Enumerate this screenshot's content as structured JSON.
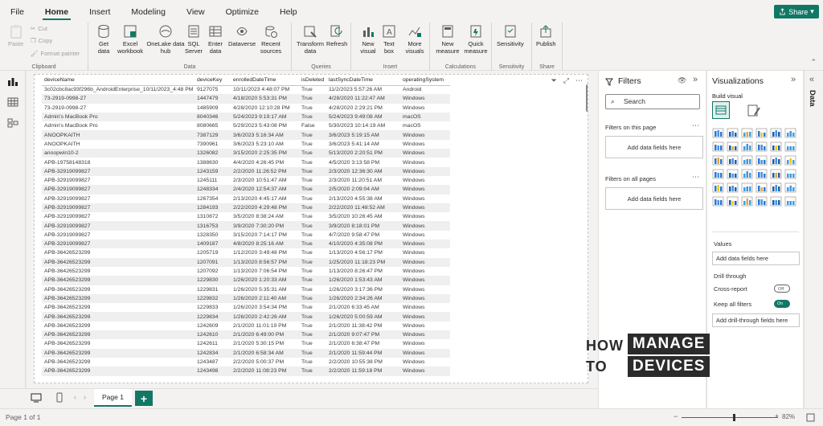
{
  "menu": {
    "items": [
      "File",
      "Home",
      "Insert",
      "Modeling",
      "View",
      "Optimize",
      "Help"
    ],
    "active": "Home",
    "share_label": "Share"
  },
  "ribbon": {
    "clipboard": {
      "paste": "Paste",
      "cut": "Cut",
      "copy": "Copy",
      "format_painter": "Format painter",
      "label": "Clipboard"
    },
    "data": {
      "get_data": "Get data",
      "excel": "Excel workbook",
      "onelake": "OneLake data hub",
      "sql": "SQL Server",
      "enter": "Enter data",
      "dataverse": "Dataverse",
      "recent": "Recent sources",
      "label": "Data"
    },
    "queries": {
      "transform": "Transform data",
      "refresh": "Refresh",
      "label": "Queries"
    },
    "insert": {
      "new_visual": "New visual",
      "text_box": "Text box",
      "more_visuals": "More visuals",
      "label": "Insert"
    },
    "calculations": {
      "new_measure": "New measure",
      "quick_measure": "Quick measure",
      "label": "Calculations"
    },
    "sensitivity": {
      "sensitivity": "Sensitivity",
      "label": "Sensitivity"
    },
    "share": {
      "publish": "Publish",
      "label": "Share"
    }
  },
  "table": {
    "columns": [
      "deviceName",
      "deviceKey",
      "enrolledDateTime",
      "isDeleted",
      "lastSyncDateTime",
      "operatingSystem"
    ],
    "rows": [
      [
        "3c02cbc8ac93f296b_AndroidEnterprise_10/11/2023_4:48 PM",
        "9127075",
        "10/11/2023 4:48:07 PM",
        "True",
        "11/2/2023 5:57:26 AM",
        "Android"
      ],
      [
        "73-2919-0998-27",
        "1447479",
        "4/18/2020 5:53:31 PM",
        "True",
        "4/28/2020 11:22:47 AM",
        "Windows"
      ],
      [
        "73-2919-0998-27",
        "1485909",
        "4/28/2020 12:10:28 PM",
        "True",
        "4/28/2020 2:29:21 PM",
        "Windows"
      ],
      [
        "Admin's MacBook Pro",
        "8040346",
        "5/24/2023 9:19:17 AM",
        "True",
        "5/24/2023 9:49:08 AM",
        "macOS"
      ],
      [
        "Admin's MacBook Pro",
        "8080665",
        "5/29/2023 5:43:08 PM",
        "False",
        "5/30/2023 10:14:19 AM",
        "macOS"
      ],
      [
        "ANOOPKAITH",
        "7387129",
        "3/6/2023 5:16:34 AM",
        "True",
        "3/6/2023 5:19:15 AM",
        "Windows"
      ],
      [
        "ANOOPKAITH",
        "7390961",
        "3/6/2023 5:23:10 AM",
        "True",
        "3/6/2023 5:41:14 AM",
        "Windows"
      ],
      [
        "anoopwin10-2",
        "1326082",
        "3/15/2020 2:25:35 PM",
        "True",
        "5/13/2020 2:20:51 PM",
        "Windows"
      ],
      [
        "APB-19758148318",
        "1388630",
        "4/4/2020 4:26:45 PM",
        "True",
        "4/5/2020 3:13:58 PM",
        "Windows"
      ],
      [
        "APB-32919099827",
        "1243159",
        "2/2/2020 11:26:52 PM",
        "True",
        "2/3/2020 12:36:30 AM",
        "Windows"
      ],
      [
        "APB-32919099827",
        "1245111",
        "2/3/2020 10:51:47 AM",
        "True",
        "2/3/2020 11:20:51 AM",
        "Windows"
      ],
      [
        "APB-32919099827",
        "1248334",
        "2/4/2020 12:54:37 AM",
        "True",
        "2/5/2020 2:09:04 AM",
        "Windows"
      ],
      [
        "APB-32919099827",
        "1267354",
        "2/13/2020 4:45:17 AM",
        "True",
        "2/13/2020 4:55:38 AM",
        "Windows"
      ],
      [
        "APB-32919099827",
        "1284193",
        "2/22/2020 4:29:48 PM",
        "True",
        "2/22/2020 11:48:52 AM",
        "Windows"
      ],
      [
        "APB-32919099827",
        "1310872",
        "3/5/2020 8:38:24 AM",
        "True",
        "3/5/2020 10:26:45 AM",
        "Windows"
      ],
      [
        "APB-32919099827",
        "1316753",
        "3/9/2020 7:30:20 PM",
        "True",
        "3/9/2020 8:18:01 PM",
        "Windows"
      ],
      [
        "APB-32919099827",
        "1328350",
        "3/15/2020 7:14:17 PM",
        "True",
        "4/7/2020 9:58:47 PM",
        "Windows"
      ],
      [
        "APB-32919099827",
        "1409187",
        "4/8/2020 8:25:16 AM",
        "True",
        "4/10/2020 4:35:08 PM",
        "Windows"
      ],
      [
        "APB-36426523299",
        "1205719",
        "1/12/2020 3:49:48 PM",
        "True",
        "1/13/2020 4:56:17 PM",
        "Windows"
      ],
      [
        "APB-36426523299",
        "1207091",
        "1/13/2020 8:56:57 PM",
        "True",
        "1/25/2020 11:18:23 PM",
        "Windows"
      ],
      [
        "APB-36426523299",
        "1207092",
        "1/13/2020 7:06:54 PM",
        "True",
        "1/13/2020 8:26:47 PM",
        "Windows"
      ],
      [
        "APB-36426523299",
        "1229830",
        "1/26/2020 1:20:33 AM",
        "True",
        "1/26/2020 1:53:43 AM",
        "Windows"
      ],
      [
        "APB-36426523299",
        "1229831",
        "1/26/2020 5:35:31 AM",
        "True",
        "1/26/2020 3:17:36 PM",
        "Windows"
      ],
      [
        "APB-36426523299",
        "1229832",
        "1/26/2020 2:11:40 AM",
        "True",
        "1/26/2020 2:34:26 AM",
        "Windows"
      ],
      [
        "APB-36426523299",
        "1229833",
        "1/26/2020 3:54:34 PM",
        "True",
        "2/1/2020 6:33:45 AM",
        "Windows"
      ],
      [
        "APB-36426523299",
        "1229834",
        "1/26/2020 2:42:26 AM",
        "True",
        "1/26/2020 5:00:59 AM",
        "Windows"
      ],
      [
        "APB-36426523299",
        "1242609",
        "2/1/2020 11:01:19 PM",
        "True",
        "2/1/2020 11:38:42 PM",
        "Windows"
      ],
      [
        "APB-36426523299",
        "1242610",
        "2/1/2020 6:49:00 PM",
        "True",
        "2/1/2020 9:07:47 PM",
        "Windows"
      ],
      [
        "APB-36426523299",
        "1242611",
        "2/1/2020 5:30:15 PM",
        "True",
        "2/1/2020 6:38:47 PM",
        "Windows"
      ],
      [
        "APB-36426523299",
        "1242834",
        "2/1/2020 6:58:34 AM",
        "True",
        "2/1/2020 11:59:44 PM",
        "Windows"
      ],
      [
        "APB-36426523299",
        "1243487",
        "2/2/2020 5:00:37 PM",
        "True",
        "2/2/2020 10:55:38 PM",
        "Windows"
      ],
      [
        "APB-36426523299",
        "1243498",
        "2/2/2020 11:08:23 PM",
        "True",
        "2/2/2020 11:59:18 PM",
        "Windows"
      ]
    ]
  },
  "filters": {
    "title": "Filters",
    "search_placeholder": "Search",
    "on_page": "Filters on this page",
    "on_all": "Filters on all pages",
    "add_fields": "Add data fields here"
  },
  "viz": {
    "title": "Visualizations",
    "build_visual": "Build visual",
    "values": "Values",
    "values_well": "Add data fields here",
    "drill_through": "Drill through",
    "cross_report": "Cross-report",
    "cross_state": "Off",
    "keep_filters": "Keep all filters",
    "keep_state": "On",
    "drill_well": "Add drill-through fields here"
  },
  "data_pane": {
    "label": "Data"
  },
  "tabs": {
    "page": "Page 1",
    "add": "+"
  },
  "status": {
    "page_of": "Page 1 of 1",
    "zoom": "82%"
  },
  "logo": {
    "how": "HOW",
    "to": "TO",
    "manage": "MANAGE",
    "devices": "DEVICES"
  },
  "colors": {
    "accent": "#117865",
    "chrome": "#f3f2f1"
  }
}
